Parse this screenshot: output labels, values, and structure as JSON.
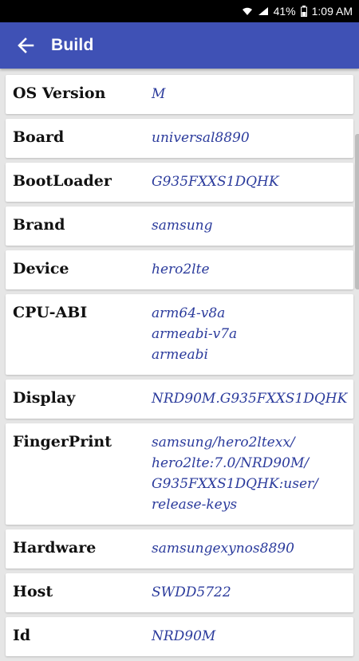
{
  "status_bar": {
    "battery": "41%",
    "time": "1:09 AM"
  },
  "app_bar": {
    "title": "Build"
  },
  "rows": [
    {
      "label": "OS Version",
      "value": [
        "M"
      ]
    },
    {
      "label": "Board",
      "value": [
        "universal8890"
      ]
    },
    {
      "label": "BootLoader",
      "value": [
        "G935FXXS1DQHK"
      ]
    },
    {
      "label": "Brand",
      "value": [
        "samsung"
      ]
    },
    {
      "label": "Device",
      "value": [
        "hero2lte"
      ]
    },
    {
      "label": "CPU-ABI",
      "value": [
        "arm64-v8a",
        "armeabi-v7a",
        "armeabi"
      ]
    },
    {
      "label": "Display",
      "value": [
        "NRD90M.G935FXXS1DQHK"
      ]
    },
    {
      "label": "FingerPrint",
      "value": [
        "samsung/hero2ltexx/",
        "hero2lte:7.0/NRD90M/",
        "G935FXXS1DQHK:user/",
        "release-keys"
      ]
    },
    {
      "label": "Hardware",
      "value": [
        "samsungexynos8890"
      ]
    },
    {
      "label": "Host",
      "value": [
        "SWDD5722"
      ]
    },
    {
      "label": "Id",
      "value": [
        "NRD90M"
      ]
    }
  ]
}
